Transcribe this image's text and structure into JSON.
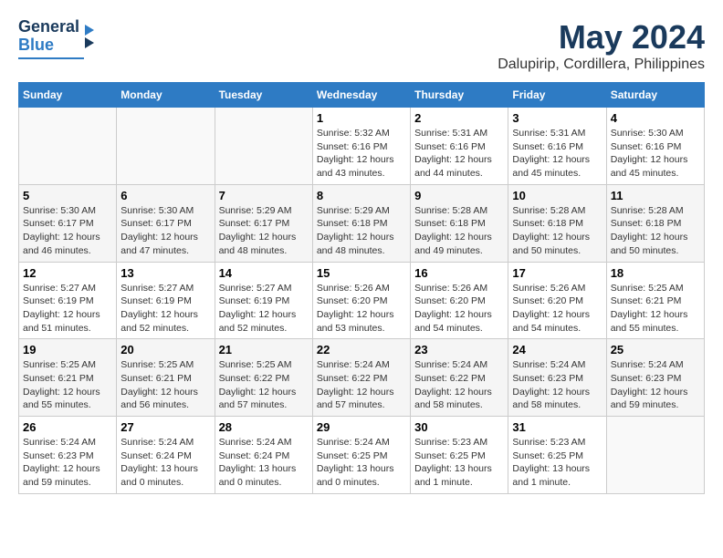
{
  "logo": {
    "line1": "General",
    "line2": "Blue"
  },
  "title": "May 2024",
  "subtitle": "Dalupirip, Cordillera, Philippines",
  "days_header": [
    "Sunday",
    "Monday",
    "Tuesday",
    "Wednesday",
    "Thursday",
    "Friday",
    "Saturday"
  ],
  "weeks": [
    [
      {
        "day": "",
        "sunrise": "",
        "sunset": "",
        "daylight": ""
      },
      {
        "day": "",
        "sunrise": "",
        "sunset": "",
        "daylight": ""
      },
      {
        "day": "",
        "sunrise": "",
        "sunset": "",
        "daylight": ""
      },
      {
        "day": "1",
        "sunrise": "Sunrise: 5:32 AM",
        "sunset": "Sunset: 6:16 PM",
        "daylight": "Daylight: 12 hours and 43 minutes."
      },
      {
        "day": "2",
        "sunrise": "Sunrise: 5:31 AM",
        "sunset": "Sunset: 6:16 PM",
        "daylight": "Daylight: 12 hours and 44 minutes."
      },
      {
        "day": "3",
        "sunrise": "Sunrise: 5:31 AM",
        "sunset": "Sunset: 6:16 PM",
        "daylight": "Daylight: 12 hours and 45 minutes."
      },
      {
        "day": "4",
        "sunrise": "Sunrise: 5:30 AM",
        "sunset": "Sunset: 6:16 PM",
        "daylight": "Daylight: 12 hours and 45 minutes."
      }
    ],
    [
      {
        "day": "5",
        "sunrise": "Sunrise: 5:30 AM",
        "sunset": "Sunset: 6:17 PM",
        "daylight": "Daylight: 12 hours and 46 minutes."
      },
      {
        "day": "6",
        "sunrise": "Sunrise: 5:30 AM",
        "sunset": "Sunset: 6:17 PM",
        "daylight": "Daylight: 12 hours and 47 minutes."
      },
      {
        "day": "7",
        "sunrise": "Sunrise: 5:29 AM",
        "sunset": "Sunset: 6:17 PM",
        "daylight": "Daylight: 12 hours and 48 minutes."
      },
      {
        "day": "8",
        "sunrise": "Sunrise: 5:29 AM",
        "sunset": "Sunset: 6:18 PM",
        "daylight": "Daylight: 12 hours and 48 minutes."
      },
      {
        "day": "9",
        "sunrise": "Sunrise: 5:28 AM",
        "sunset": "Sunset: 6:18 PM",
        "daylight": "Daylight: 12 hours and 49 minutes."
      },
      {
        "day": "10",
        "sunrise": "Sunrise: 5:28 AM",
        "sunset": "Sunset: 6:18 PM",
        "daylight": "Daylight: 12 hours and 50 minutes."
      },
      {
        "day": "11",
        "sunrise": "Sunrise: 5:28 AM",
        "sunset": "Sunset: 6:18 PM",
        "daylight": "Daylight: 12 hours and 50 minutes."
      }
    ],
    [
      {
        "day": "12",
        "sunrise": "Sunrise: 5:27 AM",
        "sunset": "Sunset: 6:19 PM",
        "daylight": "Daylight: 12 hours and 51 minutes."
      },
      {
        "day": "13",
        "sunrise": "Sunrise: 5:27 AM",
        "sunset": "Sunset: 6:19 PM",
        "daylight": "Daylight: 12 hours and 52 minutes."
      },
      {
        "day": "14",
        "sunrise": "Sunrise: 5:27 AM",
        "sunset": "Sunset: 6:19 PM",
        "daylight": "Daylight: 12 hours and 52 minutes."
      },
      {
        "day": "15",
        "sunrise": "Sunrise: 5:26 AM",
        "sunset": "Sunset: 6:20 PM",
        "daylight": "Daylight: 12 hours and 53 minutes."
      },
      {
        "day": "16",
        "sunrise": "Sunrise: 5:26 AM",
        "sunset": "Sunset: 6:20 PM",
        "daylight": "Daylight: 12 hours and 54 minutes."
      },
      {
        "day": "17",
        "sunrise": "Sunrise: 5:26 AM",
        "sunset": "Sunset: 6:20 PM",
        "daylight": "Daylight: 12 hours and 54 minutes."
      },
      {
        "day": "18",
        "sunrise": "Sunrise: 5:25 AM",
        "sunset": "Sunset: 6:21 PM",
        "daylight": "Daylight: 12 hours and 55 minutes."
      }
    ],
    [
      {
        "day": "19",
        "sunrise": "Sunrise: 5:25 AM",
        "sunset": "Sunset: 6:21 PM",
        "daylight": "Daylight: 12 hours and 55 minutes."
      },
      {
        "day": "20",
        "sunrise": "Sunrise: 5:25 AM",
        "sunset": "Sunset: 6:21 PM",
        "daylight": "Daylight: 12 hours and 56 minutes."
      },
      {
        "day": "21",
        "sunrise": "Sunrise: 5:25 AM",
        "sunset": "Sunset: 6:22 PM",
        "daylight": "Daylight: 12 hours and 57 minutes."
      },
      {
        "day": "22",
        "sunrise": "Sunrise: 5:24 AM",
        "sunset": "Sunset: 6:22 PM",
        "daylight": "Daylight: 12 hours and 57 minutes."
      },
      {
        "day": "23",
        "sunrise": "Sunrise: 5:24 AM",
        "sunset": "Sunset: 6:22 PM",
        "daylight": "Daylight: 12 hours and 58 minutes."
      },
      {
        "day": "24",
        "sunrise": "Sunrise: 5:24 AM",
        "sunset": "Sunset: 6:23 PM",
        "daylight": "Daylight: 12 hours and 58 minutes."
      },
      {
        "day": "25",
        "sunrise": "Sunrise: 5:24 AM",
        "sunset": "Sunset: 6:23 PM",
        "daylight": "Daylight: 12 hours and 59 minutes."
      }
    ],
    [
      {
        "day": "26",
        "sunrise": "Sunrise: 5:24 AM",
        "sunset": "Sunset: 6:23 PM",
        "daylight": "Daylight: 12 hours and 59 minutes."
      },
      {
        "day": "27",
        "sunrise": "Sunrise: 5:24 AM",
        "sunset": "Sunset: 6:24 PM",
        "daylight": "Daylight: 13 hours and 0 minutes."
      },
      {
        "day": "28",
        "sunrise": "Sunrise: 5:24 AM",
        "sunset": "Sunset: 6:24 PM",
        "daylight": "Daylight: 13 hours and 0 minutes."
      },
      {
        "day": "29",
        "sunrise": "Sunrise: 5:24 AM",
        "sunset": "Sunset: 6:25 PM",
        "daylight": "Daylight: 13 hours and 0 minutes."
      },
      {
        "day": "30",
        "sunrise": "Sunrise: 5:23 AM",
        "sunset": "Sunset: 6:25 PM",
        "daylight": "Daylight: 13 hours and 1 minute."
      },
      {
        "day": "31",
        "sunrise": "Sunrise: 5:23 AM",
        "sunset": "Sunset: 6:25 PM",
        "daylight": "Daylight: 13 hours and 1 minute."
      },
      {
        "day": "",
        "sunrise": "",
        "sunset": "",
        "daylight": ""
      }
    ]
  ]
}
